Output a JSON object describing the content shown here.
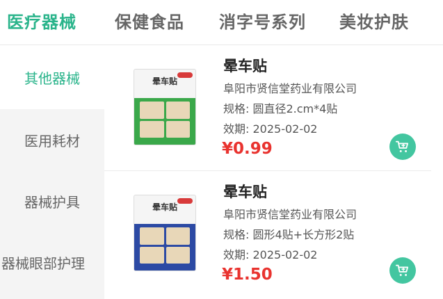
{
  "tabs": [
    {
      "label": "医疗器械",
      "active": true
    },
    {
      "label": "保健食品",
      "active": false
    },
    {
      "label": "消字号系列",
      "active": false
    },
    {
      "label": "美妆护肤",
      "active": false
    }
  ],
  "sidebar": {
    "items": [
      {
        "label": "其他器械",
        "active": true
      },
      {
        "label": "医用耗材",
        "active": false
      },
      {
        "label": "器械护具",
        "active": false
      },
      {
        "label": "器械眼部护理",
        "active": false
      }
    ]
  },
  "products": [
    {
      "name": "晕车贴",
      "company": "阜阳市贤信堂药业有限公司",
      "spec": "规格: 圆直径2.cm*4贴",
      "expiry": "效期: 2025-02-02",
      "price": "¥0.99",
      "image_text": "晕车贴"
    },
    {
      "name": "晕车贴",
      "company": "阜阳市贤信堂药业有限公司",
      "spec": "规格: 圆形4贴+长方形2贴",
      "expiry": "效期: 2025-02-02",
      "price": "¥1.50",
      "image_text": "晕车贴"
    }
  ],
  "colors": {
    "accent": "#2ab48b",
    "price": "#e9332f",
    "cart_button": "#43c6a0"
  },
  "icons": {
    "cart": "cart-plus-icon"
  }
}
